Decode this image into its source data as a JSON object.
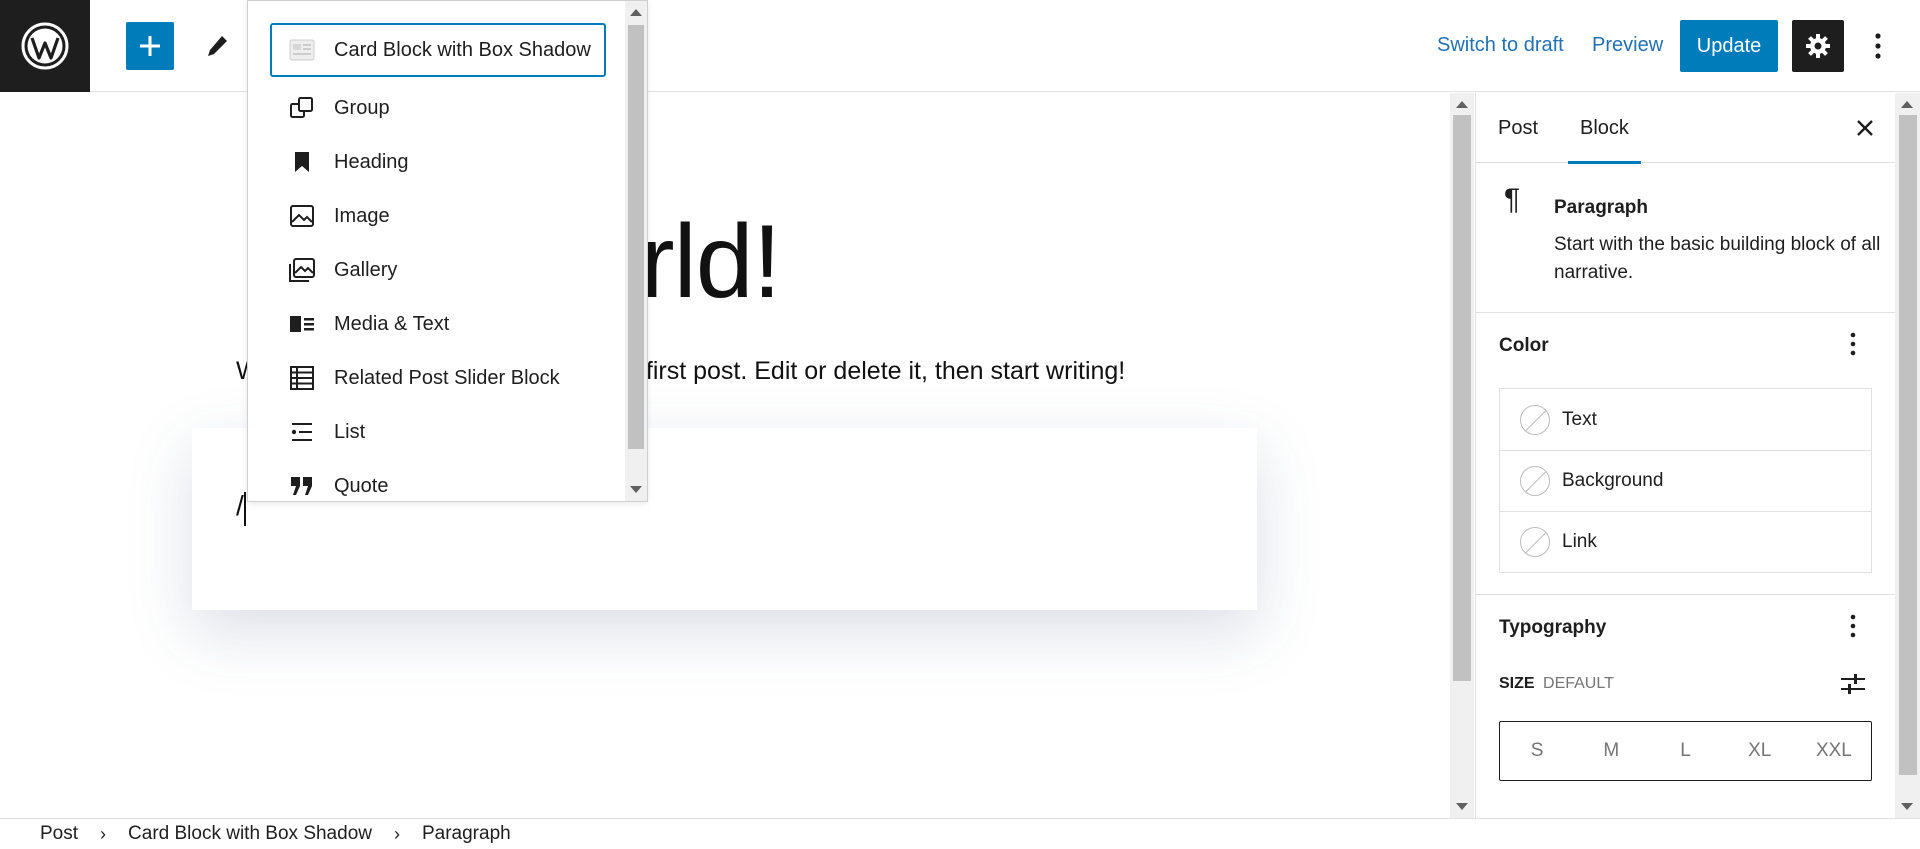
{
  "header": {
    "switch_to_draft": "Switch to draft",
    "preview": "Preview",
    "update": "Update"
  },
  "editor": {
    "title_visible": "rld!",
    "paragraph_start": "W",
    "paragraph_end": "first post. Edit or delete it, then start writing!",
    "slash_text": "/"
  },
  "inserter": {
    "items": [
      {
        "label": "Card Block with Box Shadow",
        "icon": "card-block-icon"
      },
      {
        "label": "Group",
        "icon": "group-icon"
      },
      {
        "label": "Heading",
        "icon": "heading-bookmark-icon"
      },
      {
        "label": "Image",
        "icon": "image-icon"
      },
      {
        "label": "Gallery",
        "icon": "gallery-icon"
      },
      {
        "label": "Media & Text",
        "icon": "media-text-icon"
      },
      {
        "label": "Related Post Slider Block",
        "icon": "table-icon"
      },
      {
        "label": "List",
        "icon": "list-icon"
      },
      {
        "label": "Quote",
        "icon": "quote-icon"
      }
    ]
  },
  "sidebar": {
    "tabs": [
      "Post",
      "Block"
    ],
    "block_name": "Paragraph",
    "block_description": "Start with the basic building block of all narrative.",
    "color_title": "Color",
    "color_items": [
      "Text",
      "Background",
      "Link"
    ],
    "typography_title": "Typography",
    "size_label": "SIZE",
    "size_value": "DEFAULT",
    "size_options": [
      "S",
      "M",
      "L",
      "XL",
      "XXL"
    ]
  },
  "breadcrumb": [
    "Post",
    "Card Block with Box Shadow",
    "Paragraph"
  ],
  "colors": {
    "accent": "#007cba",
    "link": "#2271b1",
    "dark": "#1e1e1e"
  }
}
